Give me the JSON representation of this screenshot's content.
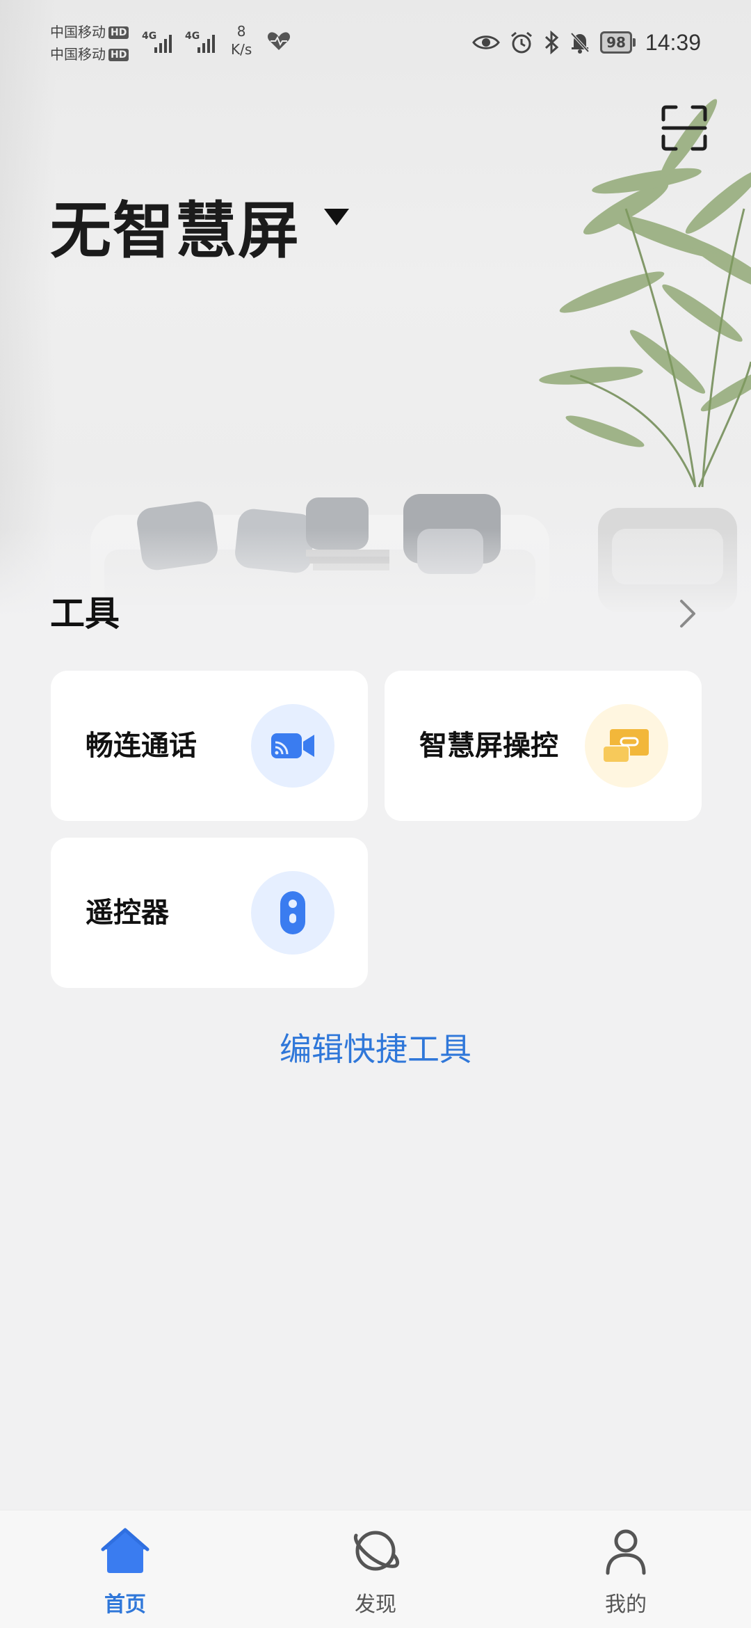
{
  "status_bar": {
    "carrier_1": "中国移动",
    "carrier_2": "中国移动",
    "hd_badge": "HD",
    "net_speed_value": "8",
    "net_speed_unit": "K/s",
    "battery_level": "98",
    "time": "14:39",
    "icons": [
      "signal-4g-icon",
      "signal-4g-icon",
      "heart-health-icon",
      "eye-icon",
      "alarm-icon",
      "bluetooth-icon",
      "mute-bell-icon",
      "battery-icon"
    ]
  },
  "header": {
    "device_title": "无智慧屏",
    "scan_icon": "scan-icon",
    "dropdown_icon": "caret-down-icon"
  },
  "tools": {
    "section_title": "工具",
    "items": [
      {
        "label": "畅连通话",
        "icon": "video-call-icon",
        "icon_bg": "#e6efff",
        "icon_color": "#3a7cf0"
      },
      {
        "label": "智慧屏操控",
        "icon": "screen-control-icon",
        "icon_bg": "#fff6e0",
        "icon_color": "#f0b43a"
      },
      {
        "label": "遥控器",
        "icon": "remote-control-icon",
        "icon_bg": "#e6efff",
        "icon_color": "#3a7cf0"
      }
    ],
    "edit_label": "编辑快捷工具"
  },
  "bottom_nav": {
    "items": [
      {
        "label": "首页",
        "icon": "home-icon",
        "active": true
      },
      {
        "label": "发现",
        "icon": "discover-planet-icon",
        "active": false
      },
      {
        "label": "我的",
        "icon": "profile-icon",
        "active": false
      }
    ]
  },
  "colors": {
    "accent": "#2f77d9",
    "background": "#f1f1f2",
    "card": "#ffffff"
  }
}
